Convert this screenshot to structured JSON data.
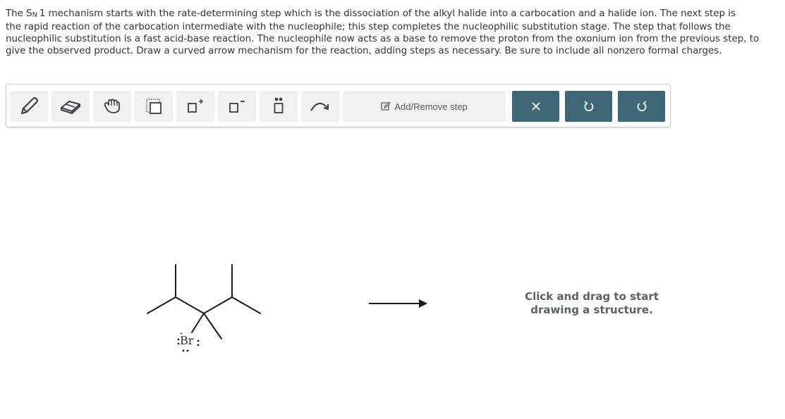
{
  "question": {
    "text_before_sub": "The S",
    "subscript": "N",
    "text_line1_after": "1 mechanism starts with the rate-determining step which is the dissociation of the alkyl halide into a carbocation and a halide ion. The next step is",
    "text_rest": "the rapid reaction of the carbocation intermediate with the nucleophile; this step completes the nucleophilic substitution stage. The step that follows the nucleophilic substitution is a fast acid-base reaction. The nucleophile now acts as a base to remove the proton from the oxonium ion from the previous step, to give the observed product. Draw a curved arrow mechanism for the reaction, adding steps as necessary. Be sure to include all nonzero formal charges."
  },
  "toolbar": {
    "add_remove_label": "Add/Remove step",
    "tools": [
      "pencil-icon",
      "eraser-icon",
      "hand-icon",
      "selection-icon",
      "positive-charge-icon",
      "negative-charge-icon",
      "lone-pair-icon",
      "curved-arrow-icon"
    ],
    "actions": [
      "close-icon",
      "undo-icon",
      "redo-icon"
    ],
    "colors": {
      "tool_bg": "#f0f1f1",
      "action_bg": "#3e6878",
      "border": "#c9cccf"
    }
  },
  "canvas": {
    "atom_label": "Br",
    "hint_line1": "Click and drag to start",
    "hint_line2": "drawing a structure."
  }
}
